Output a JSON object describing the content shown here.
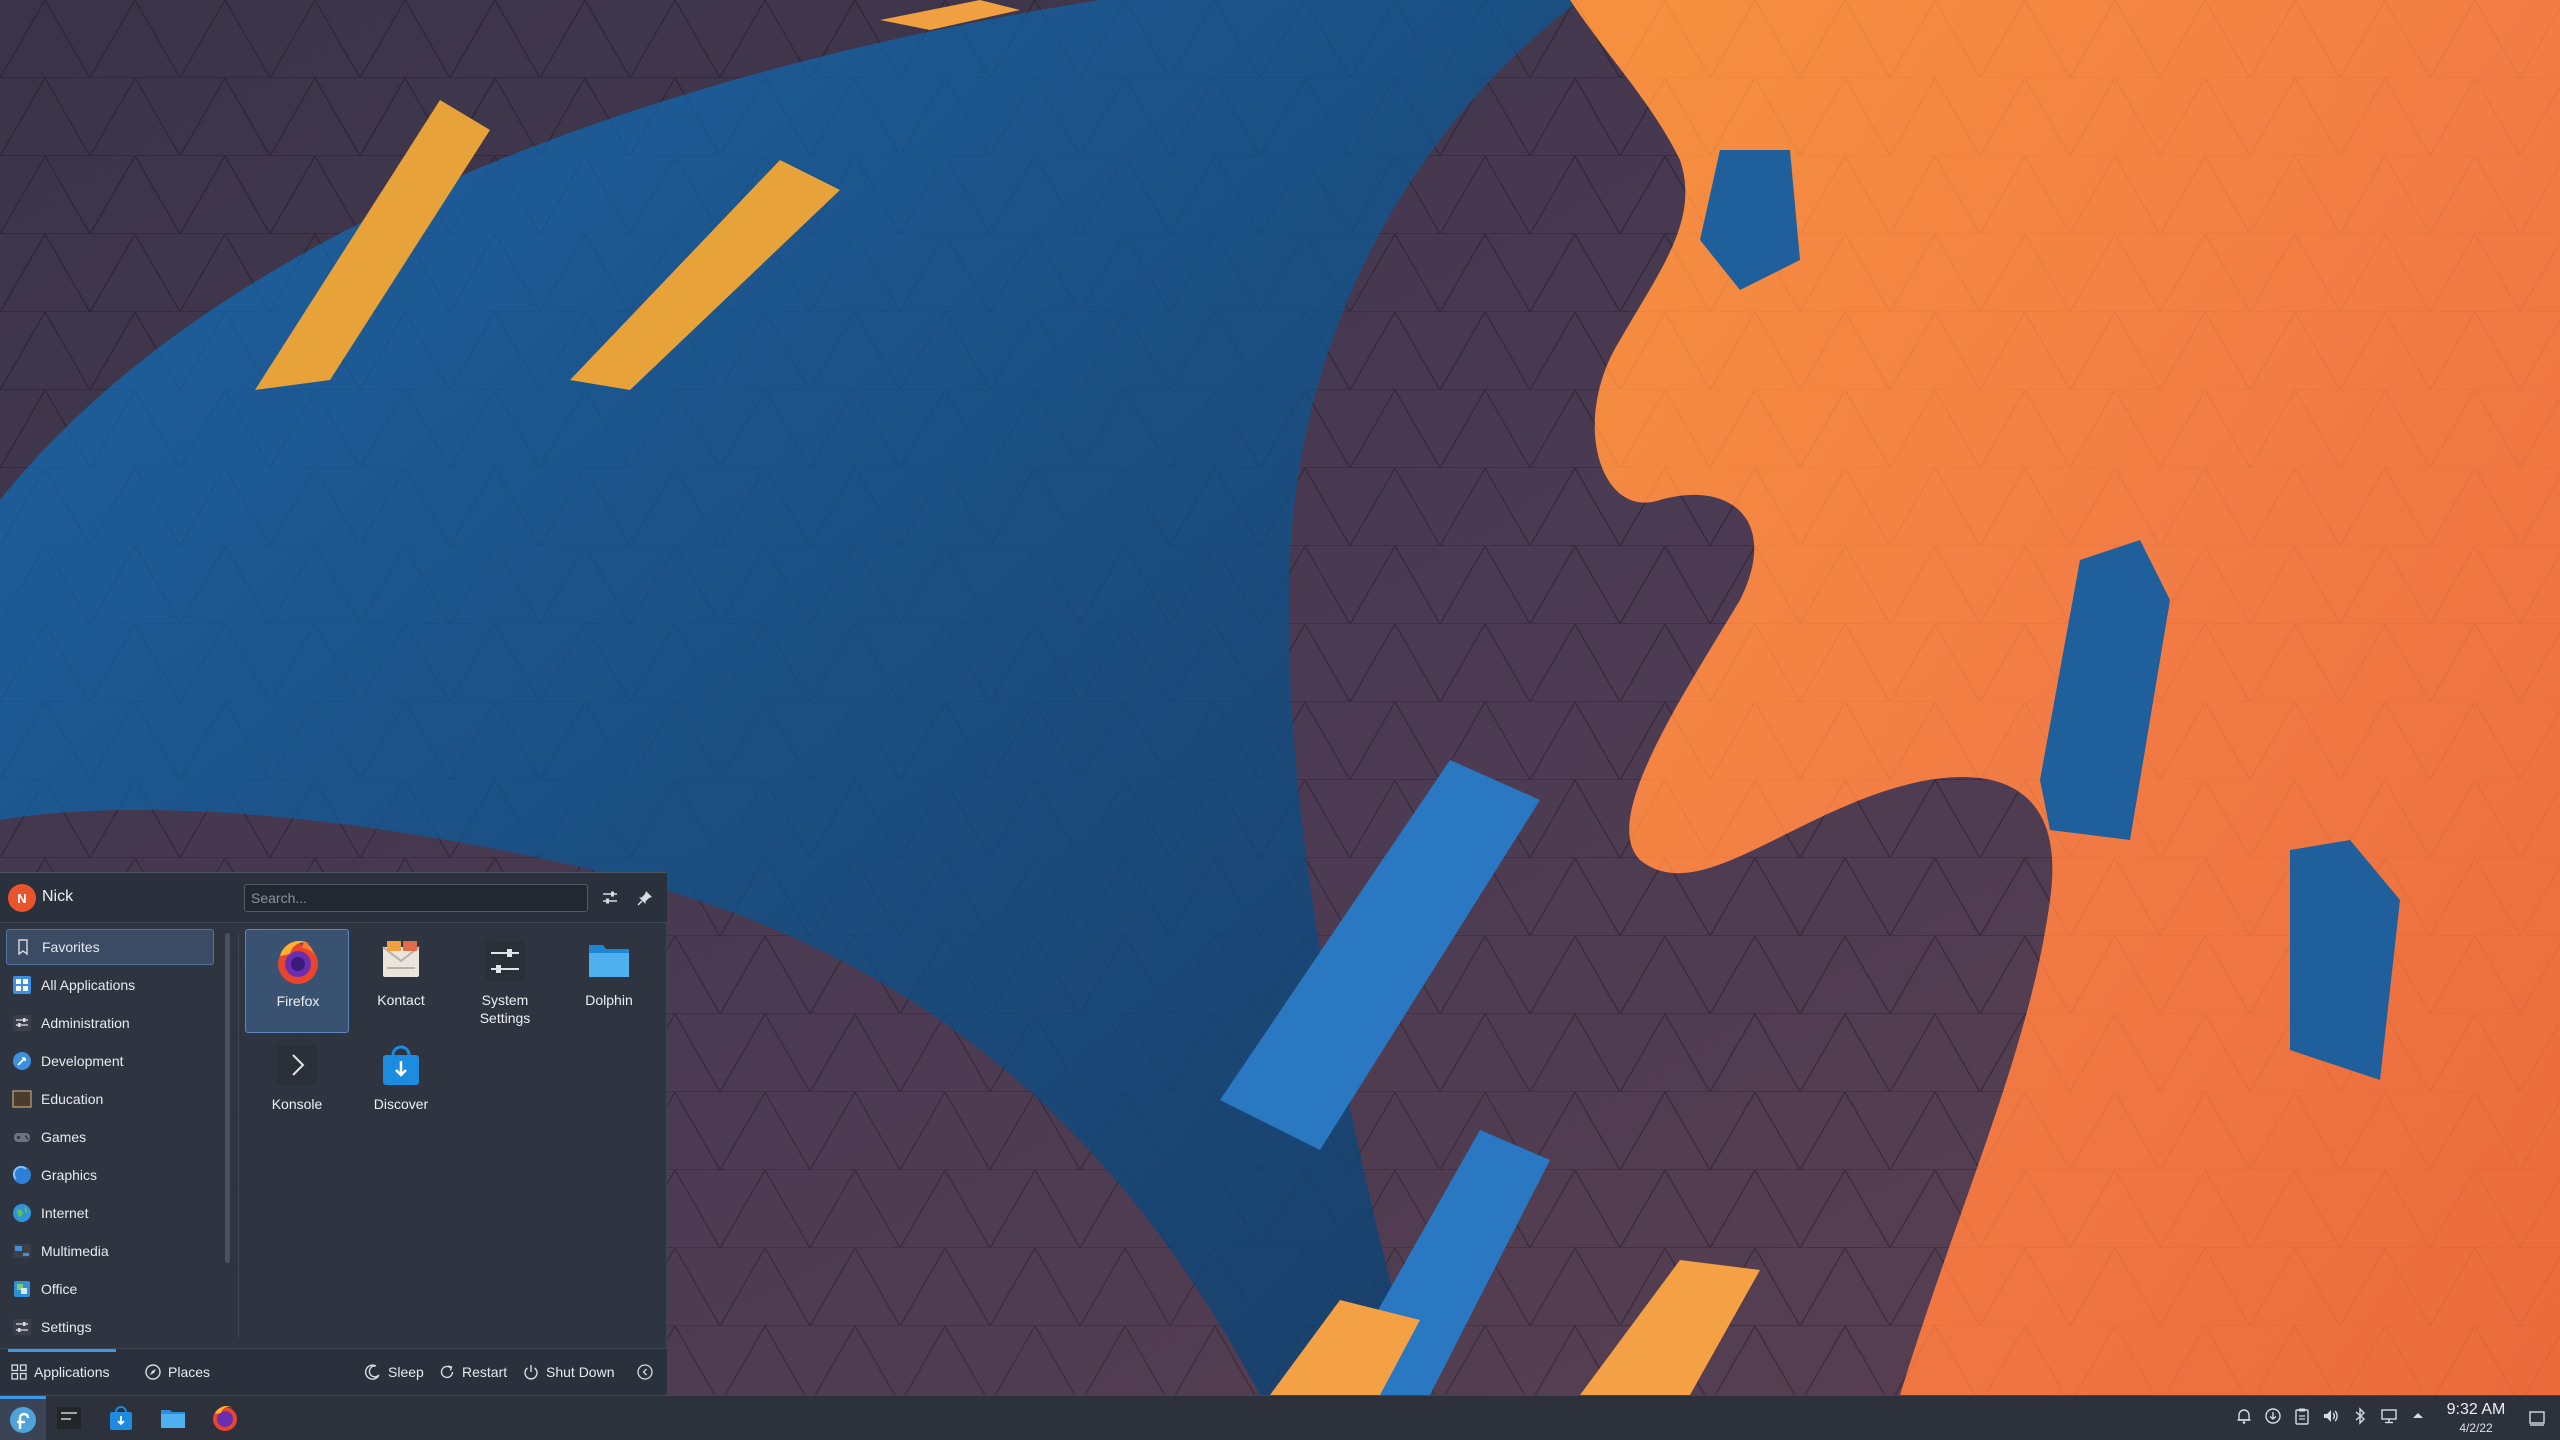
{
  "user": {
    "initial": "N",
    "name": "Nick"
  },
  "search": {
    "placeholder": "Search..."
  },
  "categories": [
    {
      "label": "Favorites",
      "icon": "bookmark-icon"
    },
    {
      "label": "All Applications",
      "icon": "all-applications-icon"
    },
    {
      "label": "Administration",
      "icon": "administration-icon"
    },
    {
      "label": "Development",
      "icon": "development-icon"
    },
    {
      "label": "Education",
      "icon": "education-icon"
    },
    {
      "label": "Games",
      "icon": "games-icon"
    },
    {
      "label": "Graphics",
      "icon": "graphics-icon"
    },
    {
      "label": "Internet",
      "icon": "internet-icon"
    },
    {
      "label": "Multimedia",
      "icon": "multimedia-icon"
    },
    {
      "label": "Office",
      "icon": "office-icon"
    },
    {
      "label": "Settings",
      "icon": "settings-icon"
    }
  ],
  "favorites": [
    {
      "label": "Firefox",
      "icon": "firefox-icon"
    },
    {
      "label": "Kontact",
      "icon": "kontact-icon"
    },
    {
      "label": "System Settings",
      "icon": "system-settings-icon"
    },
    {
      "label": "Dolphin",
      "icon": "dolphin-icon"
    },
    {
      "label": "Konsole",
      "icon": "konsole-icon"
    },
    {
      "label": "Discover",
      "icon": "discover-icon"
    }
  ],
  "footer": {
    "tabs": {
      "applications": "Applications",
      "places": "Places"
    },
    "power": {
      "sleep": "Sleep",
      "restart": "Restart",
      "shutdown": "Shut Down"
    }
  },
  "taskbar": {
    "pinned": [
      "konsole-icon",
      "discover-icon",
      "dolphin-icon",
      "firefox-icon"
    ],
    "tray": [
      "notification-bell-icon",
      "update-icon",
      "clipboard-icon",
      "volume-icon",
      "bluetooth-icon",
      "network-icon",
      "expand-tray-icon"
    ],
    "clock": {
      "time": "9:32 AM",
      "date": "4/2/22"
    }
  },
  "colors": {
    "accent": "#3d96e6",
    "selection": "#3a5272",
    "panel": "#2d313b"
  }
}
